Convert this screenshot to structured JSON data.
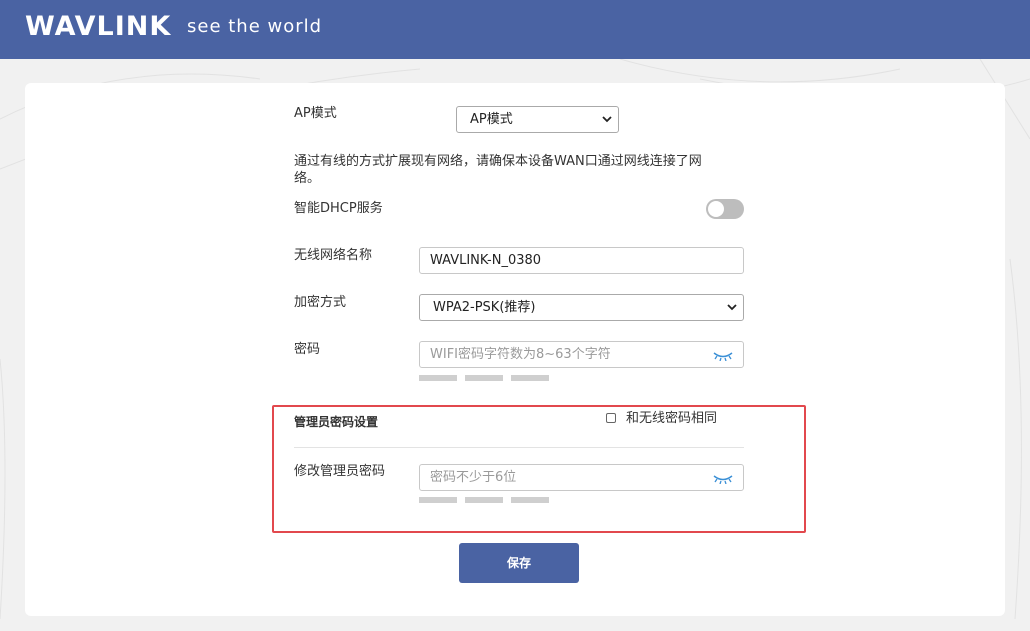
{
  "header": {
    "logo_text": "WAVLINK",
    "tagline": "see the world"
  },
  "form": {
    "mode": {
      "label": "AP模式",
      "selected": "AP模式"
    },
    "description": "通过有线的方式扩展现有网络，请确保本设备WAN口通过网线连接了网络。",
    "dhcp": {
      "label": "智能DHCP服务",
      "enabled": false
    },
    "ssid": {
      "label": "无线网络名称",
      "value": "WAVLINK-N_0380"
    },
    "encryption": {
      "label": "加密方式",
      "selected": "WPA2-PSK(推荐)"
    },
    "wifi_password": {
      "label": "密码",
      "placeholder": "WIFI密码字符数为8~63个字符",
      "value": ""
    },
    "admin": {
      "section_title": "管理员密码设置",
      "same_as_wireless_label": "和无线密码相同",
      "same_as_wireless_checked": false,
      "password_label": "修改管理员密码",
      "password_placeholder": "密码不少于6位",
      "value": ""
    },
    "save_label": "保存"
  },
  "colors": {
    "header_bg": "#4a63a3",
    "button_bg": "#4a63a3",
    "highlight_border": "#e2484d",
    "eye_icon": "#3a8fd6"
  }
}
